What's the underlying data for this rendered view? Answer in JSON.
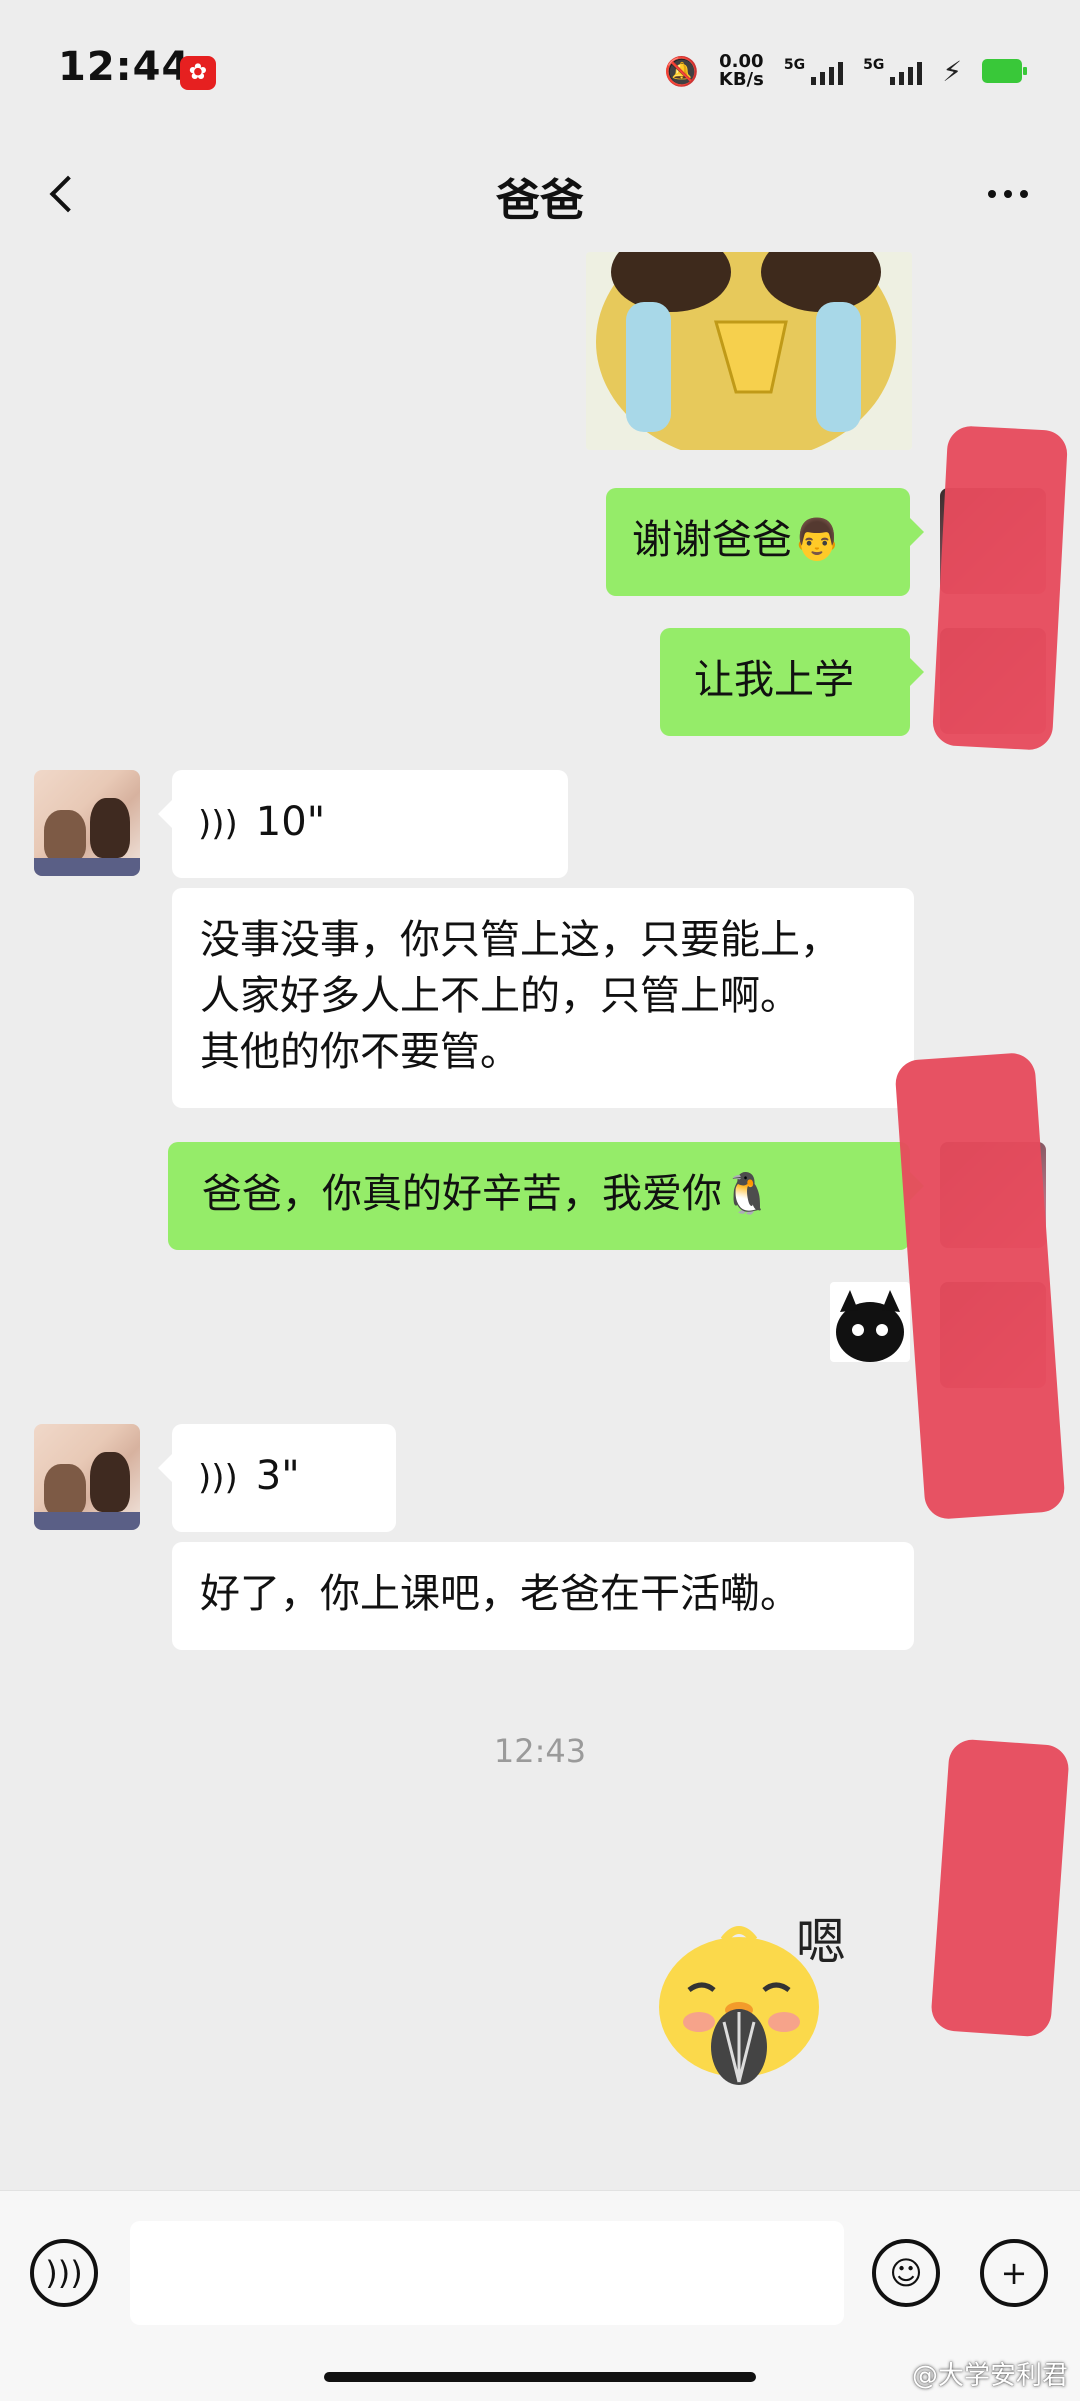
{
  "status_bar": {
    "time": "12:44",
    "network_speed_value": "0.00",
    "network_speed_unit": "KB/s",
    "sim1_label": "5G",
    "sim2_label": "5G",
    "icons": [
      "app-badge-icon",
      "mute-bell-icon",
      "signal-icon",
      "signal-icon",
      "charging-icon",
      "battery-icon"
    ]
  },
  "header": {
    "title": "爸爸"
  },
  "messages": {
    "m1": "谢谢爸爸👨",
    "m2": "让我上学",
    "voice1_duration": "10\"",
    "text1_line1": "没事没事，你只管上这，只要能上，",
    "text1_line2": "人家好多人上不上的，只管上啊。",
    "text1_line3": "其他的你不要管。",
    "m3": "爸爸，你真的好辛苦，我爱你🐧",
    "voice2_duration": "3\"",
    "text2": "好了，你上课吧，老爸在干活嘞。",
    "timestamp": "12:43"
  },
  "stickers": {
    "chick_label": "嗯"
  },
  "input_bar": {
    "icons": [
      "voice-input-icon",
      "emoji-icon",
      "plus-icon"
    ]
  },
  "watermark": "@大学安利君",
  "colors": {
    "sent_bubble": "#95ec69",
    "received_bubble": "#ffffff",
    "background": "#ededed"
  }
}
